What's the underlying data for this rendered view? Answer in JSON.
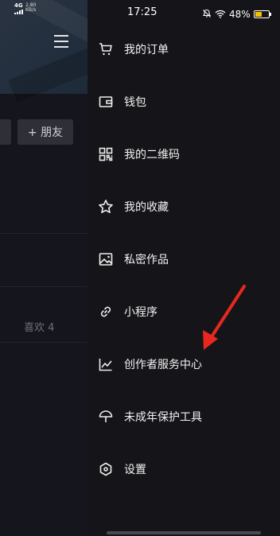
{
  "status_bar": {
    "network_type": "4G",
    "net_speed_value": "2.80",
    "net_speed_unit": "KB/s",
    "time": "17:25",
    "battery_percent": "48%",
    "battery_level": 0.48,
    "battery_color": "#f2c200"
  },
  "background_page": {
    "add_friend_button": "+ 朋友",
    "likes_tab": "喜欢 4"
  },
  "drawer": {
    "items": [
      {
        "label": "我的订单",
        "icon": "cart-icon"
      },
      {
        "label": "钱包",
        "icon": "wallet-icon"
      },
      {
        "label": "我的二维码",
        "icon": "qr-code-icon"
      },
      {
        "label": "我的收藏",
        "icon": "star-icon"
      },
      {
        "label": "私密作品",
        "icon": "private-image-icon"
      },
      {
        "label": "小程序",
        "icon": "mini-program-link-icon"
      },
      {
        "label": "创作者服务中心",
        "icon": "chart-line-icon"
      },
      {
        "label": "未成年保护工具",
        "icon": "umbrella-icon"
      },
      {
        "label": "设置",
        "icon": "settings-icon"
      }
    ]
  },
  "annotation": {
    "arrow_color": "#e8281e"
  }
}
